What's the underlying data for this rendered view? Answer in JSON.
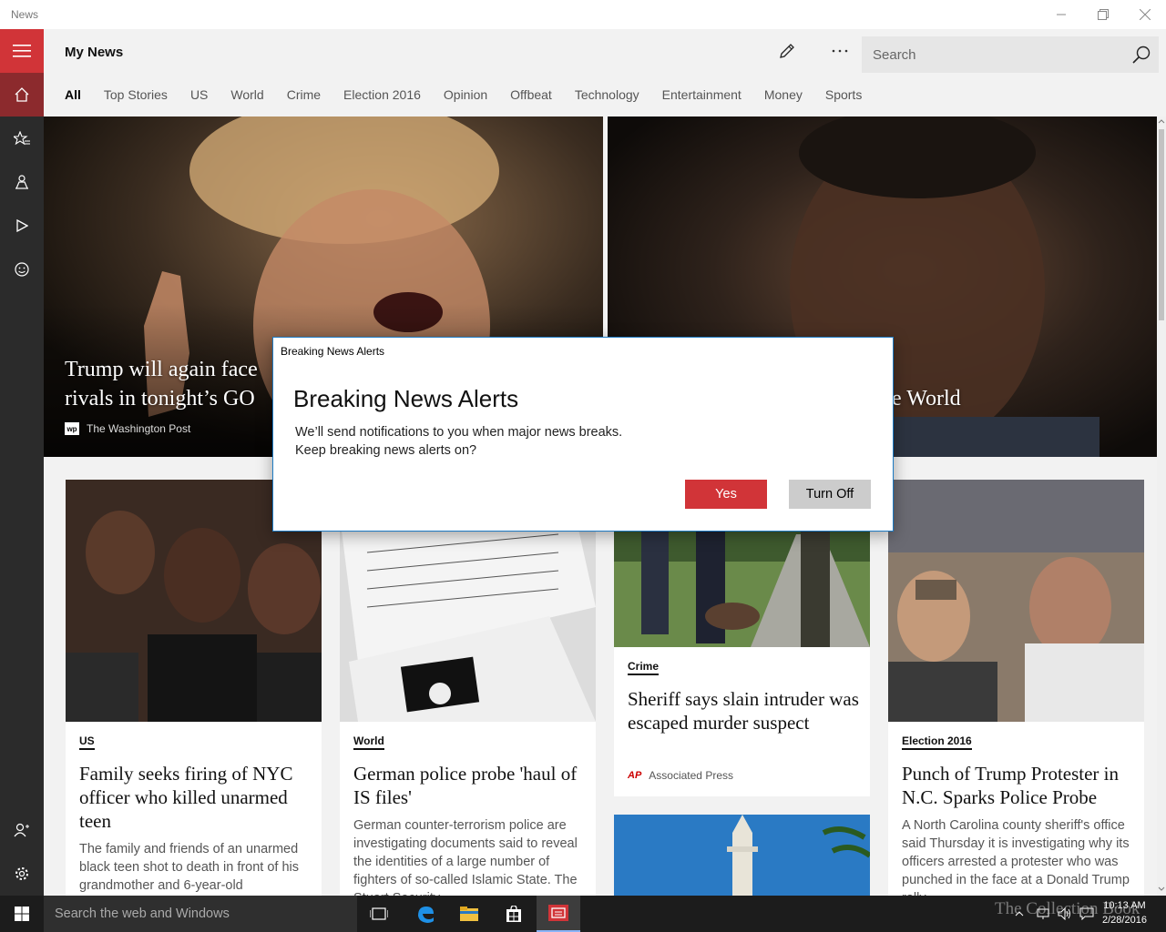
{
  "window": {
    "title": "News"
  },
  "header": {
    "title": "My News",
    "search_placeholder": "Search"
  },
  "tabs": [
    "All",
    "Top Stories",
    "US",
    "World",
    "Crime",
    "Election 2016",
    "Opinion",
    "Offbeat",
    "Technology",
    "Entertainment",
    "Money",
    "Sports"
  ],
  "active_tab": "All",
  "sidebar": {
    "top_items": [
      "menu-icon",
      "home-icon",
      "favorites-icon",
      "local-icon",
      "video-icon",
      "sports-icon"
    ],
    "bottom_items": [
      "sign-in-icon",
      "settings-icon"
    ]
  },
  "hero": [
    {
      "title_line1": "Trump will again face",
      "title_line2": "rivals in tonight’s GO",
      "source": "The Washington Post"
    },
    {
      "title_visible": "e World"
    }
  ],
  "cards": [
    {
      "category": "US",
      "headline": "Family seeks firing of NYC officer who killed unarmed teen",
      "summary": "The family and friends of an unarmed black teen shot to death in front of his grandmother and 6-year-old"
    },
    {
      "category": "World",
      "headline": "German police probe 'haul of IS files'",
      "summary": "German counter-terrorism police are investigating documents said to reveal the identities of a large number of fighters of so-called Islamic State. The Stuart Security"
    },
    {
      "category": "Crime",
      "headline": "Sheriff says slain intruder was escaped murder suspect",
      "source": "Associated Press",
      "source_logo": "AP"
    },
    {
      "category": "Election 2016",
      "headline": "Punch of Trump Protester in N.C. Sparks Police Probe",
      "summary": "A North Carolina county sheriff's office said Thursday it is investigating why its officers arrested a protester who was punched in the face at a Donald Trump rally."
    }
  ],
  "dialog": {
    "caption": "Breaking News Alerts",
    "title": "Breaking News Alerts",
    "line1": "We’ll send notifications to you when major news breaks.",
    "line2": "Keep breaking news alerts on?",
    "yes_label": "Yes",
    "off_label": "Turn Off"
  },
  "taskbar": {
    "search_placeholder": "Search the web and Windows",
    "time": "10:13 AM",
    "date": "2/28/2016"
  },
  "watermark": "The Collection Book",
  "colors": {
    "accent": "#d13438",
    "sidebar": "#2b2b2b",
    "taskbar": "#1c1c1c"
  }
}
